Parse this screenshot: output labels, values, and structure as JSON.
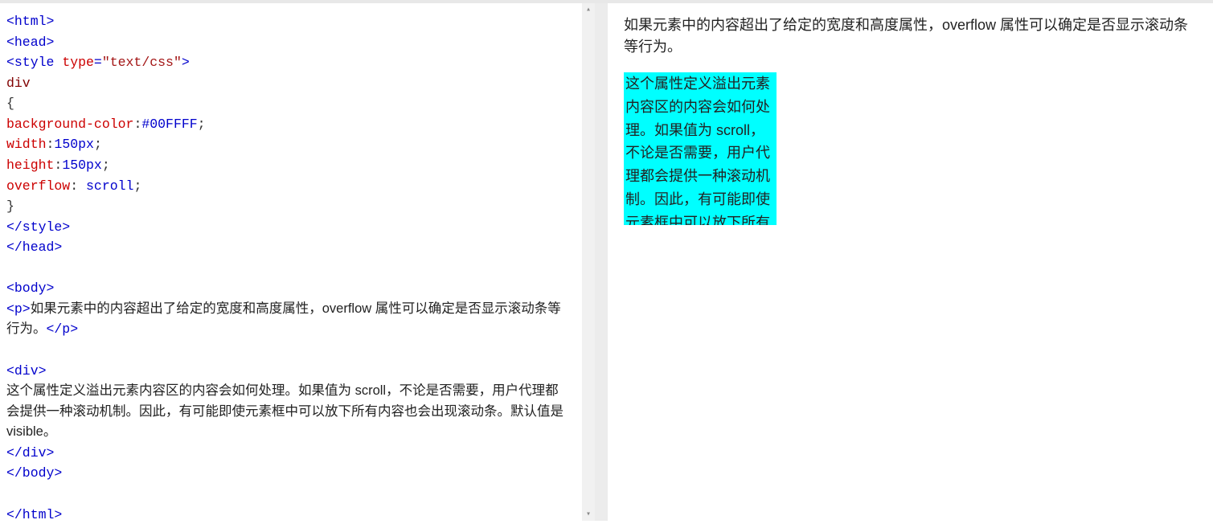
{
  "editor": {
    "tokens": [
      [
        [
          "tag",
          "<html>"
        ]
      ],
      [
        [
          "tag",
          "<head>"
        ]
      ],
      [
        [
          "tag",
          "<style "
        ],
        [
          "attr",
          "type"
        ],
        [
          "tag",
          "="
        ],
        [
          "val",
          "\"text/css\""
        ],
        [
          "tag",
          ">"
        ]
      ],
      [
        [
          "sel",
          "div"
        ]
      ],
      [
        [
          "brace",
          "{"
        ]
      ],
      [
        [
          "prop",
          "background-color"
        ],
        [
          "punc",
          ":"
        ],
        [
          "pval",
          "#00FFFF"
        ],
        [
          "punc",
          ";"
        ]
      ],
      [
        [
          "prop",
          "width"
        ],
        [
          "punc",
          ":"
        ],
        [
          "pval",
          "150px"
        ],
        [
          "punc",
          ";"
        ]
      ],
      [
        [
          "prop",
          "height"
        ],
        [
          "punc",
          ":"
        ],
        [
          "pval",
          "150px"
        ],
        [
          "punc",
          ";"
        ]
      ],
      [
        [
          "prop",
          "overflow"
        ],
        [
          "punc",
          ": "
        ],
        [
          "pval",
          "scroll"
        ],
        [
          "punc",
          ";"
        ]
      ],
      [
        [
          "brace",
          "}"
        ]
      ],
      [
        [
          "tag",
          "</style>"
        ]
      ],
      [
        [
          "tag",
          "</head>"
        ]
      ],
      [
        [
          "",
          ""
        ]
      ],
      [
        [
          "tag",
          "<body>"
        ]
      ],
      [
        [
          "tag",
          "<p>"
        ],
        [
          "txt",
          "如果元素中的内容超出了给定的宽度和高度属性，overflow 属性可以确定是否显示滚动条等行为。"
        ],
        [
          "tag",
          "</p>"
        ]
      ],
      [
        [
          "",
          ""
        ]
      ],
      [
        [
          "tag",
          "<div>"
        ]
      ],
      [
        [
          "txt",
          "这个属性定义溢出元素内容区的内容会如何处理。如果值为 scroll，不论是否需要，用户代理都会提供一种滚动机制。因此，有可能即使元素框中可以放下所有内容也会出现滚动条。默认值是 visible。"
        ]
      ],
      [
        [
          "tag",
          "</div>"
        ]
      ],
      [
        [
          "tag",
          "</body>"
        ]
      ],
      [
        [
          "",
          ""
        ]
      ],
      [
        [
          "tag",
          "</html>"
        ]
      ]
    ]
  },
  "preview": {
    "intro": "如果元素中的内容超出了给定的宽度和高度属性，overflow 属性可以确定是否显示滚动条等行为。",
    "box_text": "这个属性定义溢出元素内容区的内容会如何处理。如果值为 scroll，不论是否需要，用户代理都会提供一种滚动机制。因此，有可能即使元素框中可以放下所有内容也会出现滚动条。默认值是 visible。",
    "box_bg": "#00FFFF"
  }
}
